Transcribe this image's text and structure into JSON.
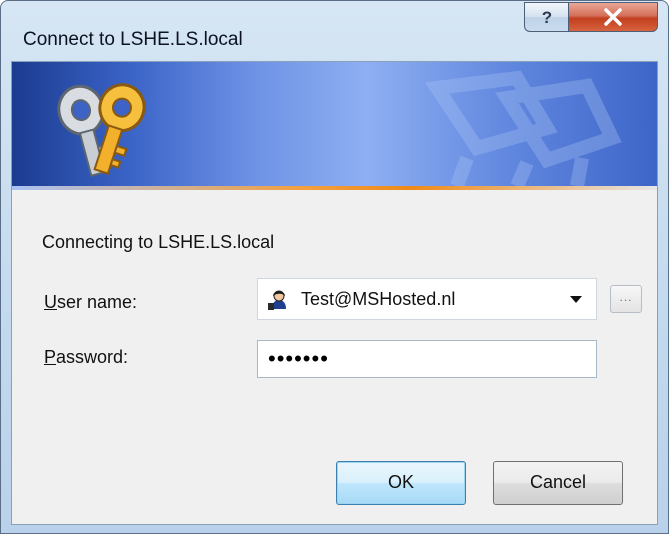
{
  "window": {
    "title": "Connect to LSHE.LS.local",
    "help_label": "?",
    "close_label": "X"
  },
  "banner": {
    "icon": "keys-icon",
    "watermark_icon": "keys-watermark-icon",
    "colors": {
      "deep": "#1b3b8f",
      "light": "#8eaff2",
      "stripe_accent": "#f08a18"
    }
  },
  "form": {
    "connecting_text": "Connecting to LSHE.LS.local",
    "username_label_mnemonic": "U",
    "username_label_rest": "ser name:",
    "username_value": "Test@MSHosted.nl",
    "username_icon": "user-avatar-icon",
    "browse_label": "...",
    "password_label_mnemonic": "P",
    "password_label_rest": "assword:",
    "password_dots": "•••••••"
  },
  "buttons": {
    "ok": "OK",
    "cancel": "Cancel"
  }
}
